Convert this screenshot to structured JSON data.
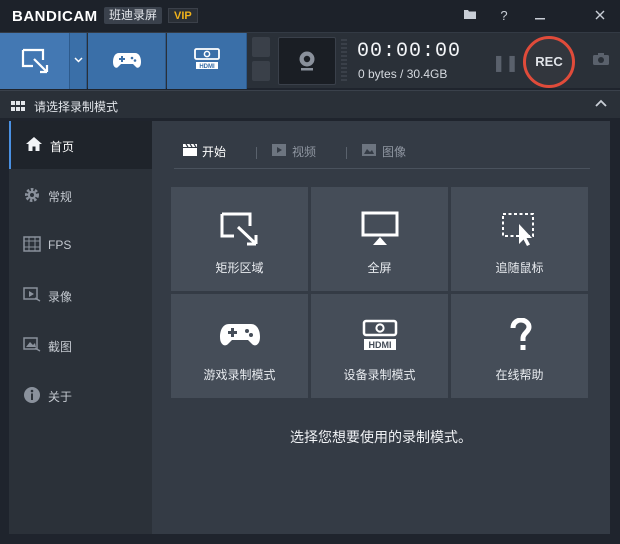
{
  "titlebar": {
    "brand_left": "BANDI",
    "brand_right": "CAM",
    "product_name": "班迪录屏",
    "vip_badge": "VIP",
    "icons": [
      "folder-icon",
      "help-icon",
      "minimize-icon",
      "close-icon"
    ]
  },
  "toolbar": {
    "modes": [
      {
        "name": "rectangle-mode",
        "icon": "rectangle-select-icon"
      },
      {
        "name": "game-mode",
        "icon": "gamepad-icon"
      },
      {
        "name": "hdmi-mode",
        "icon": "hdmi-device-icon"
      }
    ],
    "timer": "00:00:00",
    "size": "0 bytes / 30.4GB",
    "rec_label": "REC"
  },
  "section": {
    "title": "请选择录制模式"
  },
  "sidebar": {
    "items": [
      {
        "label": "首页",
        "icon": "home-icon",
        "active": true
      },
      {
        "label": "常规",
        "icon": "gear-icon",
        "active": false
      },
      {
        "label": "FPS",
        "icon": "fps-icon",
        "active": false
      },
      {
        "label": "录像",
        "icon": "video-icon",
        "active": false
      },
      {
        "label": "截图",
        "icon": "image-icon",
        "active": false
      },
      {
        "label": "关于",
        "icon": "info-icon",
        "active": false
      }
    ]
  },
  "main": {
    "tabs": [
      {
        "label": "开始",
        "icon": "clapper-icon",
        "active": true
      },
      {
        "label": "视频",
        "icon": "play-icon",
        "active": false
      },
      {
        "label": "图像",
        "icon": "picture-icon",
        "active": false
      }
    ],
    "cards": [
      {
        "label": "矩形区域",
        "icon": "rectangle-area-icon"
      },
      {
        "label": "全屏",
        "icon": "monitor-icon"
      },
      {
        "label": "追随鼠标",
        "icon": "cursor-follow-icon"
      },
      {
        "label": "游戏录制模式",
        "icon": "gamepad-icon"
      },
      {
        "label": "设备录制模式",
        "icon": "hdmi-device-icon"
      },
      {
        "label": "在线帮助",
        "icon": "question-icon"
      }
    ],
    "hint": "选择您想要使用的录制模式。"
  },
  "colors": {
    "accent_blue": "#4378b3",
    "rec_red": "#e04b3a",
    "vip_gold": "#f0b21b"
  }
}
